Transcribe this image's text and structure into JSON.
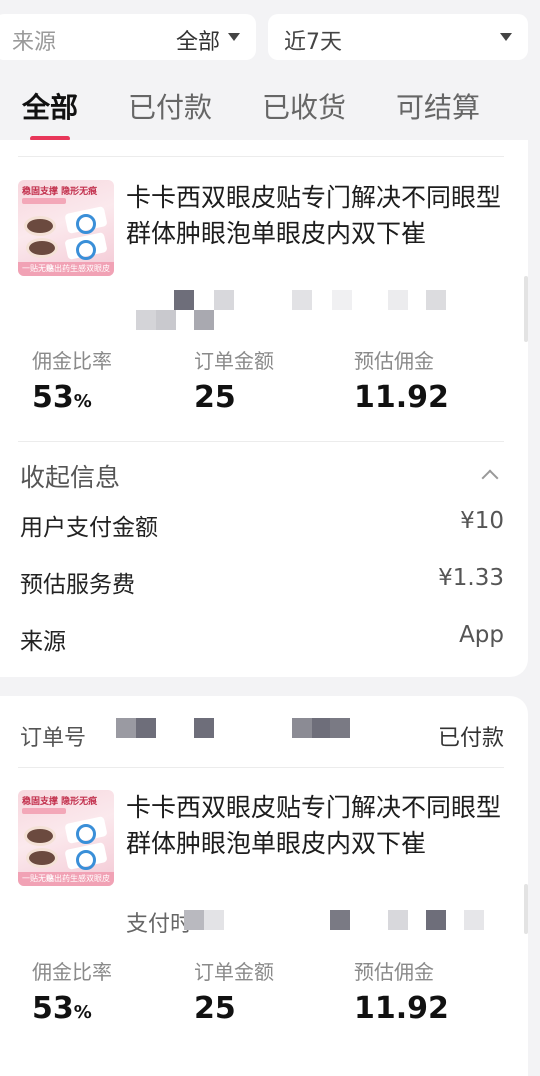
{
  "filters": {
    "source_label": "来源",
    "source_value": "全部",
    "date_value": "近7天"
  },
  "tabs": [
    {
      "label": "全部",
      "active": true
    },
    {
      "label": "已付款",
      "active": false
    },
    {
      "label": "已收货",
      "active": false
    },
    {
      "label": "可结算",
      "active": false
    }
  ],
  "accent_color": "#e8375a",
  "orders": [
    {
      "product_title": "卡卡西双眼皮贴专门解决不同眼型群体肿眼泡单眼皮内双下崔",
      "stats": {
        "rate_label": "佣金比率",
        "rate_value": "53",
        "rate_unit": "%",
        "amount_label": "订单金额",
        "amount_value": "25",
        "commission_label": "预估佣金",
        "commission_value": "11.92"
      },
      "collapse_label": "收起信息",
      "details": [
        {
          "key": "用户支付金额",
          "value": "¥10"
        },
        {
          "key": "预估服务费",
          "value": "¥1.33"
        },
        {
          "key": "来源",
          "value": "App"
        }
      ]
    },
    {
      "order_no_label": "订单号",
      "status": "已付款",
      "product_title": "卡卡西双眼皮贴专门解决不同眼型群体肿眼泡单眼皮内双下崔",
      "pay_time_label": "支付时",
      "stats": {
        "rate_label": "佣金比率",
        "rate_value": "53",
        "rate_unit": "%",
        "amount_label": "订单金额",
        "amount_value": "25",
        "commission_label": "预估佣金",
        "commission_value": "11.92"
      }
    }
  ],
  "thumbnail_text": {
    "top": "稳固支撑 隐形无痕",
    "bottom_left": "一贴无痕",
    "bottom_right": "贴出药生感双眼皮"
  }
}
